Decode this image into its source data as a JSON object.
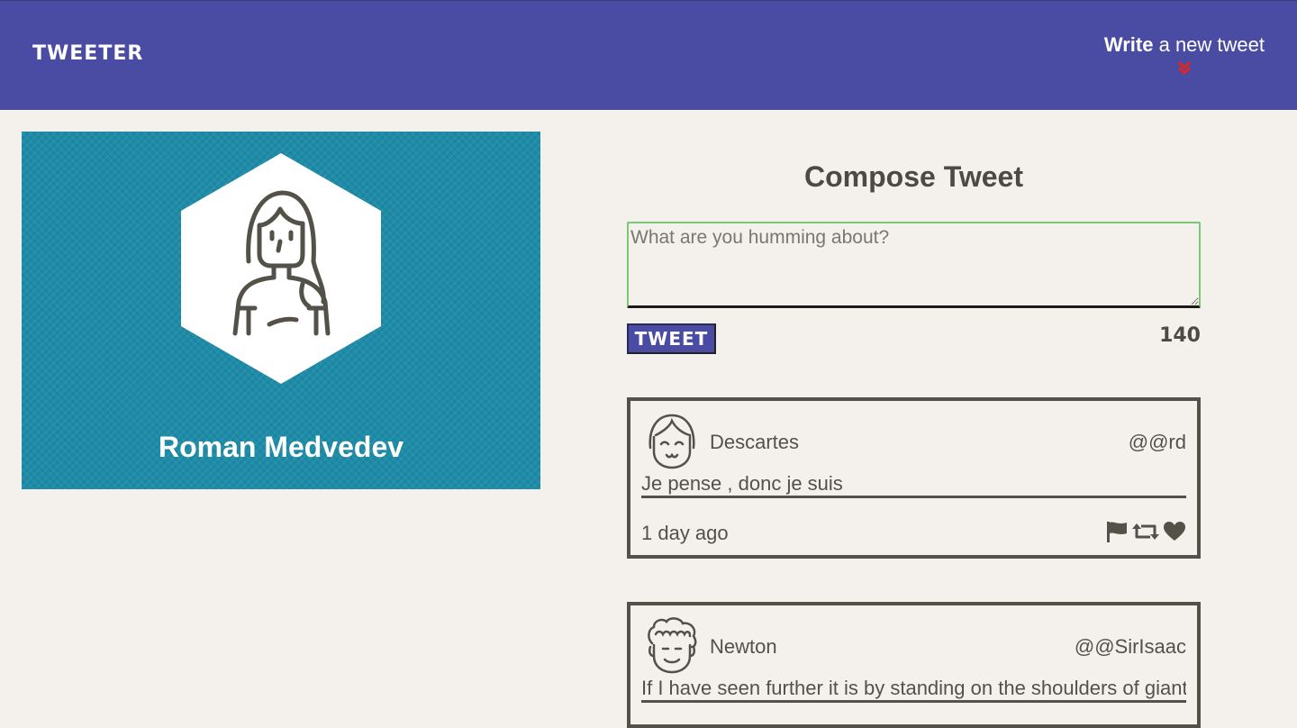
{
  "nav": {
    "brand": "TWEETER",
    "write_bold": "Write",
    "write_rest": " a new tweet",
    "chevron_icon": "double-chevron-down-icon",
    "chevron_color": "#e0261f"
  },
  "profile": {
    "name": "Roman Medvedev",
    "avatar_icon": "user-avatar-icon"
  },
  "compose": {
    "title": "Compose Tweet",
    "placeholder": "What are you humming about?",
    "button_label": "TWEET",
    "counter": "140"
  },
  "tweets": [
    {
      "name": "Descartes",
      "handle": "@@rd",
      "body": "Je pense , donc je suis",
      "time": "1 day ago",
      "avatar_icon": "avatar-icon"
    },
    {
      "name": "Newton",
      "handle": "@@SirIsaac",
      "body": "If I have seen further it is by standing on the shoulders of giants",
      "time": "",
      "avatar_icon": "avatar-icon"
    }
  ],
  "colors": {
    "nav_bg": "#4a4ba2",
    "profile_bg": "#1e8ca8",
    "page_bg": "#f4f1ec",
    "text": "#545149"
  }
}
